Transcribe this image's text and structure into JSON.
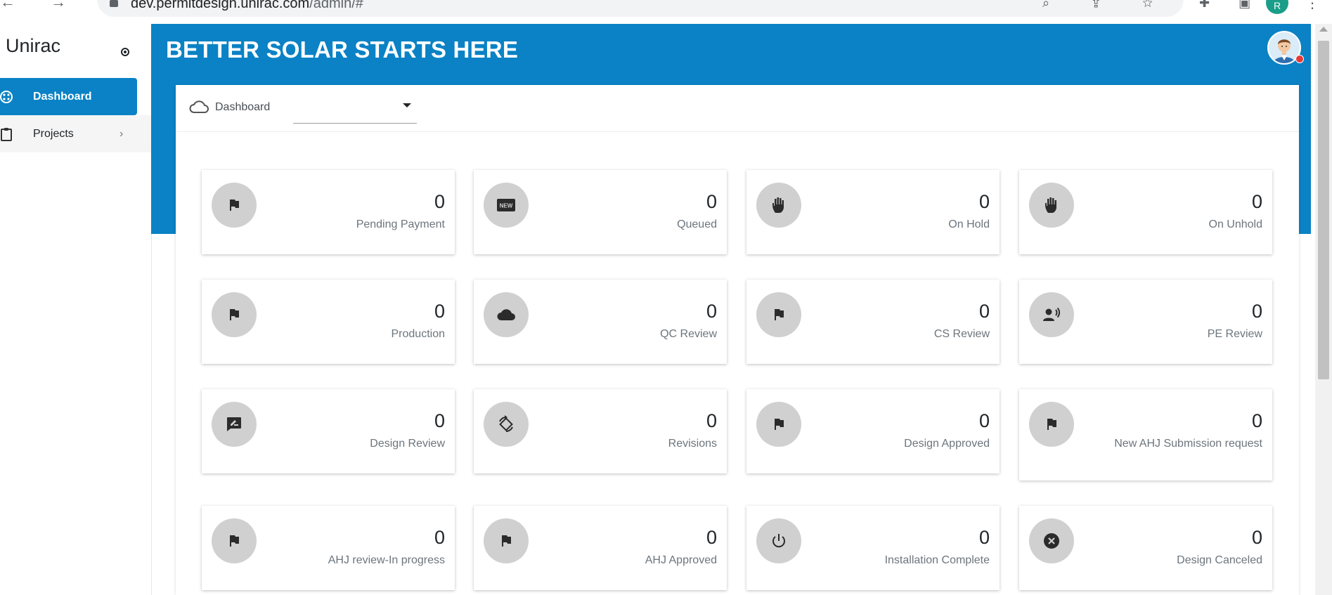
{
  "browser": {
    "url_host": "dev.permitdesign.unirac.com",
    "url_path": "/admin/#",
    "profile_initial": "R"
  },
  "sidebar": {
    "brand": "Unirac",
    "items": [
      {
        "label": "Dashboard",
        "icon": "dashboard-icon",
        "active": true
      },
      {
        "label": "Projects",
        "icon": "clipboard-icon",
        "active": false
      }
    ]
  },
  "header": {
    "title": "BETTER SOLAR STARTS HERE",
    "accent_color": "#0a82c5"
  },
  "panel": {
    "breadcrumb": "Dashboard",
    "select_value": ""
  },
  "cards": [
    {
      "count": "0",
      "label": "Pending Payment",
      "icon": "flag-icon"
    },
    {
      "count": "0",
      "label": "Queued",
      "icon": "new-badge-icon"
    },
    {
      "count": "0",
      "label": "On Hold",
      "icon": "hand-icon"
    },
    {
      "count": "0",
      "label": "On Unhold",
      "icon": "hand-icon"
    },
    {
      "count": "0",
      "label": "Production",
      "icon": "flag-icon"
    },
    {
      "count": "0",
      "label": "QC Review",
      "icon": "cloud-icon"
    },
    {
      "count": "0",
      "label": "CS Review",
      "icon": "flag-icon"
    },
    {
      "count": "0",
      "label": "PE Review",
      "icon": "record-voice-icon"
    },
    {
      "count": "0",
      "label": "Design Review",
      "icon": "rate-review-icon"
    },
    {
      "count": "0",
      "label": "Revisions",
      "icon": "rotate-icon"
    },
    {
      "count": "0",
      "label": "Design Approved",
      "icon": "flag-icon"
    },
    {
      "count": "0",
      "label": "New AHJ Submission request",
      "icon": "flag-icon"
    },
    {
      "count": "0",
      "label": "AHJ review-In progress",
      "icon": "flag-icon"
    },
    {
      "count": "0",
      "label": "AHJ Approved",
      "icon": "flag-icon"
    },
    {
      "count": "0",
      "label": "Installation Complete",
      "icon": "power-icon"
    },
    {
      "count": "0",
      "label": "Design Canceled",
      "icon": "cancel-icon"
    }
  ]
}
